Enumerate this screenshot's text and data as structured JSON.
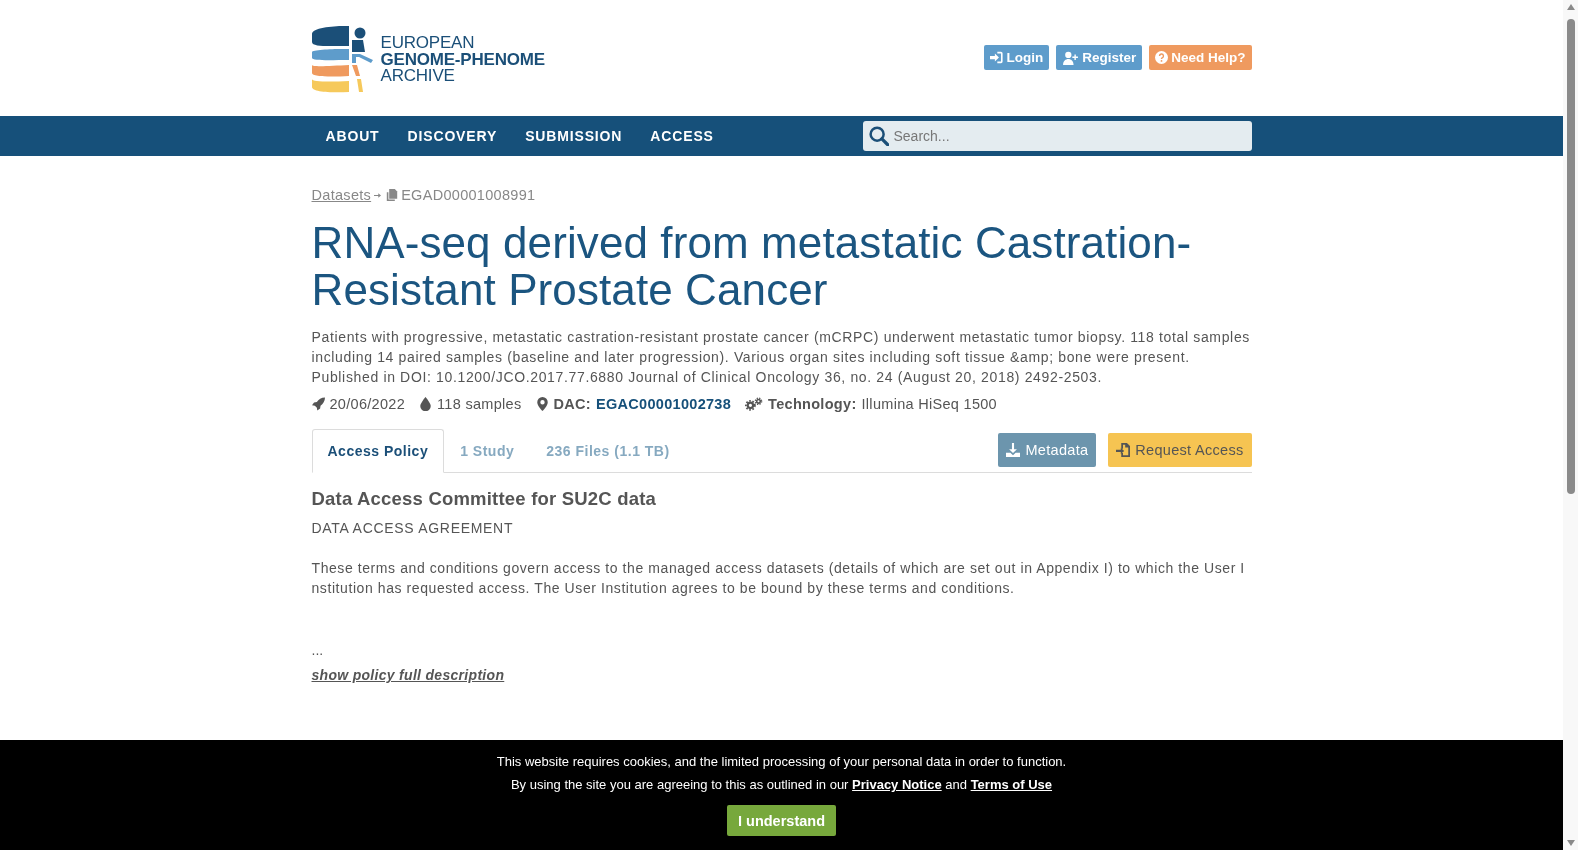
{
  "header": {
    "logo_text": "EUROPEAN **GENOME-PHENOME** ARCHIVE",
    "buttons": [
      {
        "kind": "login",
        "label": "Login"
      },
      {
        "kind": "register",
        "label": "Register"
      },
      {
        "kind": "help",
        "label": "Need Help?"
      }
    ]
  },
  "nav": {
    "items": [
      "ABOUT",
      "DISCOVERY",
      "SUBMISSION",
      "ACCESS"
    ],
    "search": {
      "placeholder": "Search..."
    }
  },
  "breadcrumb": [
    {
      "kind": "link",
      "text": "Datasets"
    },
    {
      "kind": "current",
      "text": "EGAD00001008991"
    }
  ],
  "dataset": {
    "title": "RNA-seq derived from metastatic Castration-Resistant Prostate Cancer",
    "description": [
      "Patients with progressive, metastatic castration-resistant prostate cancer (mCRPC) underwent metastatic tumor biopsy. 118 total samples including 14 paired samples (baseline and later progression). Various organ sites including soft tissue &amp; bone were present.",
      "Published in DOI: 10.1200/JCO.2017.77.6880 Journal of Clinical Oncology 36, no. 24 (August 20, 2018) 2492-2503."
    ],
    "meta": [
      {
        "kind": "date",
        "value": "20/06/2022"
      },
      {
        "kind": "samples",
        "value": "118 samples"
      },
      {
        "kind": "dac",
        "label": "DAC:",
        "value": "EGAC00001002738"
      },
      {
        "kind": "technology",
        "label": "Technology:",
        "value": "Illumina HiSeq 1500"
      }
    ]
  },
  "tabs": [
    {
      "label": "Access Policy",
      "selected": true
    },
    {
      "label": "1 Study",
      "selected": false
    },
    {
      "label": "236 Files (1.1 TB)",
      "selected": false
    }
  ],
  "actions": [
    {
      "kind": "metadata",
      "label": "Metadata"
    },
    {
      "kind": "request",
      "label": "Request Access"
    }
  ],
  "policy": {
    "title": "Data Access Committee for SU2C data",
    "subtitle": "DATA ACCESS AGREEMENT",
    "body": "These terms and conditions govern access to the managed access datasets (details of which are set out in Appendix I) to which the User Institution has requested access. The User Institution agrees to be bound by these terms and conditions.",
    "ellipsis": "...",
    "more_link": "show policy full description"
  },
  "cookie_banner": {
    "line_1": "This website requires cookies, and the limited processing of your personal data in order to function.",
    "line_2": [
      {
        "kind": "text",
        "text": "By using the site you are agreeing to this as outlined in our"
      },
      {
        "kind": "link",
        "text": "Privacy Notice"
      },
      {
        "kind": "text",
        "text": "and"
      },
      {
        "kind": "link",
        "text": "Terms of Use"
      }
    ],
    "button": "I understand"
  }
}
